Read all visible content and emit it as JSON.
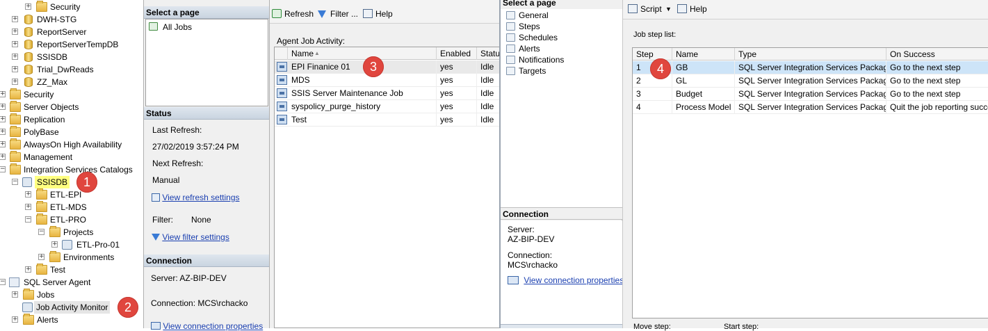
{
  "tree": {
    "items": [
      {
        "label": "Security",
        "indent": 2
      },
      {
        "label": "DWH-STG",
        "indent": 1
      },
      {
        "label": "ReportServer",
        "indent": 1
      },
      {
        "label": "ReportServerTempDB",
        "indent": 1
      },
      {
        "label": "SSISDB",
        "indent": 1
      },
      {
        "label": "Trial_DwReads",
        "indent": 1
      },
      {
        "label": "ZZ_Max",
        "indent": 1
      },
      {
        "label": "Security",
        "indent": 0
      },
      {
        "label": "Server Objects",
        "indent": 0
      },
      {
        "label": "Replication",
        "indent": 0
      },
      {
        "label": "PolyBase",
        "indent": 0
      },
      {
        "label": "AlwaysOn High Availability",
        "indent": 0
      },
      {
        "label": "Management",
        "indent": 0
      },
      {
        "label": "Integration Services Catalogs",
        "indent": 0
      },
      {
        "label": "SSISDB",
        "indent": 1
      },
      {
        "label": "ETL-EPI",
        "indent": 2
      },
      {
        "label": "ETL-MDS",
        "indent": 2
      },
      {
        "label": "ETL-PRO",
        "indent": 2
      },
      {
        "label": "Projects",
        "indent": 3
      },
      {
        "label": "ETL-Pro-01",
        "indent": 4
      },
      {
        "label": "Environments",
        "indent": 3
      },
      {
        "label": "Test",
        "indent": 2
      },
      {
        "label": "SQL Server Agent",
        "indent": 0
      },
      {
        "label": "Jobs",
        "indent": 1
      },
      {
        "label": "Job Activity Monitor",
        "indent": 1
      },
      {
        "label": "Alerts",
        "indent": 1
      }
    ]
  },
  "badges": {
    "b1": "1",
    "b2": "2",
    "b3": "3",
    "b4": "4"
  },
  "monitor": {
    "select_page_title": "Select a page",
    "all_jobs": "All Jobs",
    "status_title": "Status",
    "last_refresh_label": "Last Refresh:",
    "last_refresh_value": "27/02/2019 3:57:24 PM",
    "next_refresh_label": "Next Refresh:",
    "next_refresh_value": "Manual",
    "view_refresh_settings": "View refresh settings",
    "filter_label": "Filter:",
    "filter_value": "None",
    "view_filter_settings": "View filter settings",
    "connection_title": "Connection",
    "server_text": "Server: AZ-BIP-DEV",
    "connection_text": "Connection: MCS\\rchacko",
    "view_connection_properties": "View connection properties"
  },
  "activity": {
    "toolbar": {
      "refresh": "Refresh",
      "filter": "Filter ...",
      "help": "Help"
    },
    "list_label": "Agent Job Activity:",
    "columns": {
      "name": "Name",
      "enabled": "Enabled",
      "status": "Status"
    },
    "sort_glyph": "▲",
    "rows": [
      {
        "name": "EPI Finanice 01",
        "enabled": "yes",
        "status": "Idle"
      },
      {
        "name": "MDS",
        "enabled": "yes",
        "status": "Idle"
      },
      {
        "name": "SSIS Server Maintenance Job",
        "enabled": "yes",
        "status": "Idle"
      },
      {
        "name": "syspolicy_purge_history",
        "enabled": "yes",
        "status": "Idle"
      },
      {
        "name": "Test",
        "enabled": "yes",
        "status": "Idle"
      }
    ]
  },
  "job_props": {
    "select_page_title": "Select a page",
    "pages": [
      "General",
      "Steps",
      "Schedules",
      "Alerts",
      "Notifications",
      "Targets"
    ],
    "connection_title": "Connection",
    "server_label": "Server:",
    "server_value": "AZ-BIP-DEV",
    "connection_label": "Connection:",
    "connection_value": "MCS\\rchacko",
    "view_connection_properties": "View connection properties"
  },
  "steps": {
    "toolbar": {
      "script": "Script",
      "help": "Help"
    },
    "list_label": "Job step list:",
    "columns": {
      "step": "Step",
      "name": "Name",
      "type": "Type",
      "on_success": "On Success"
    },
    "rows": [
      {
        "step": "1",
        "name": "GB",
        "type": "SQL Server Integration Services Package",
        "on_success": "Go to the next step"
      },
      {
        "step": "2",
        "name": "GL",
        "type": "SQL Server Integration Services Package",
        "on_success": "Go to the next step"
      },
      {
        "step": "3",
        "name": "Budget",
        "type": "SQL Server Integration Services Package",
        "on_success": "Go to the next step"
      },
      {
        "step": "4",
        "name": "Process Model",
        "type": "SQL Server Integration Services Package",
        "on_success": "Quit the job reporting success"
      }
    ],
    "move_step": "Move step:",
    "start_step": "Start step:"
  }
}
